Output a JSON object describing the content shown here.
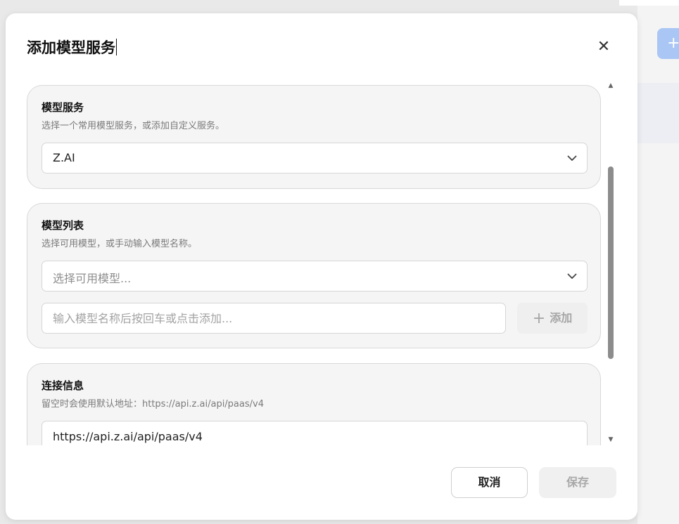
{
  "dialog": {
    "title": "添加模型服务",
    "close_label": "✕"
  },
  "model_service": {
    "title": "模型服务",
    "description": "选择一个常用模型服务，或添加自定义服务。",
    "selected": "Z.AI"
  },
  "model_list": {
    "title": "模型列表",
    "description": "选择可用模型，或手动输入模型名称。",
    "select_placeholder": "选择可用模型...",
    "input_placeholder": "输入模型名称后按回车或点击添加...",
    "add_label": "添加"
  },
  "connection": {
    "title": "连接信息",
    "description": "留空时会使用默认地址：https://api.z.ai/api/paas/v4",
    "url_value": "https://api.z.ai/api/paas/v4"
  },
  "footer": {
    "cancel_label": "取消",
    "save_label": "保存"
  }
}
